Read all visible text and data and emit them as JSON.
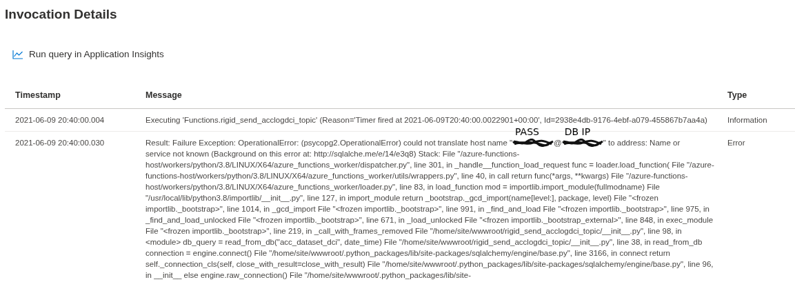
{
  "title": "Invocation Details",
  "query_link": {
    "label": "Run query in Application Insights"
  },
  "table": {
    "columns": [
      "Timestamp",
      "Message",
      "Type"
    ],
    "rows": [
      {
        "timestamp": "2021-06-09 20:40:00.004",
        "message": [
          {
            "kind": "text",
            "text": "Executing 'Functions.rigid_send_acclogdci_topic' (Reason='Timer fired at 2021-06-09T20:40:00.0022901+00:00', Id=2938e4db-9176-4ebf-a079-455867b7aa4a)"
          }
        ],
        "type": "Information"
      },
      {
        "timestamp": "2021-06-09 20:40:00.030",
        "message": [
          {
            "kind": "text",
            "text": "Result: Failure Exception: OperationalError: (psycopg2.OperationalError) could not translate host name \""
          },
          {
            "kind": "redaction",
            "note": "PASS"
          },
          {
            "kind": "text",
            "text": "@"
          },
          {
            "kind": "redaction",
            "note": "DB IP"
          },
          {
            "kind": "text",
            "text": "\" to address: Name or"
          },
          {
            "kind": "paragraph",
            "text": "service not known (Background on this error at: http://sqlalche.me/e/14/e3q8) Stack: File \"/azure-functions-host/workers/python/3.8/LINUX/X64/azure_functions_worker/dispatcher.py\", line 301, in _handle__function_load_request func = loader.load_function( File \"/azure-functions-host/workers/python/3.8/LINUX/X64/azure_functions_worker/utils/wrappers.py\", line 40, in call return func(*args, **kwargs) File \"/azure-functions-host/workers/python/3.8/LINUX/X64/azure_functions_worker/loader.py\", line 83, in load_function mod = importlib.import_module(fullmodname) File \"/usr/local/lib/python3.8/importlib/__init__.py\", line 127, in import_module return _bootstrap._gcd_import(name[level:], package, level) File \"<frozen importlib._bootstrap>\", line 1014, in _gcd_import File \"<frozen importlib._bootstrap>\", line 991, in _find_and_load File \"<frozen importlib._bootstrap>\", line 975, in _find_and_load_unlocked File \"<frozen importlib._bootstrap>\", line 671, in _load_unlocked File \"<frozen importlib._bootstrap_external>\", line 848, in exec_module File \"<frozen importlib._bootstrap>\", line 219, in _call_with_frames_removed File \"/home/site/wwwroot/rigid_send_acclogdci_topic/__init__.py\", line 98, in <module> db_query = read_from_db(\"acc_dataset_dci\", date_time) File \"/home/site/wwwroot/rigid_send_acclogdci_topic/__init__.py\", line 38, in read_from_db connection = engine.connect() File \"/home/site/wwwroot/.python_packages/lib/site-packages/sqlalchemy/engine/base.py\", line 3166, in connect return self._connection_cls(self, close_with_result=close_with_result) File \"/home/site/wwwroot/.python_packages/lib/site-packages/sqlalchemy/engine/base.py\", line 96, in __init__ else engine.raw_connection() File \"/home/site/wwwroot/.python_packages/lib/site-"
          }
        ],
        "type": "Error"
      }
    ]
  }
}
